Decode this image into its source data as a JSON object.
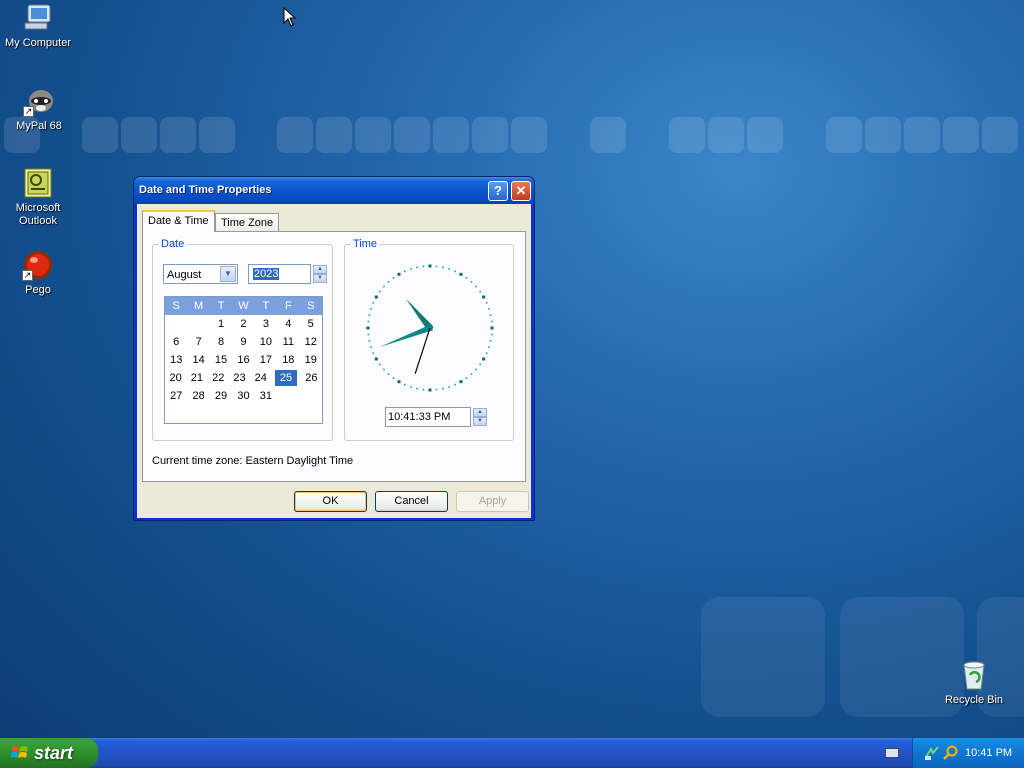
{
  "desktop": {
    "icons": [
      {
        "label": "My Computer"
      },
      {
        "label": "MyPal 68"
      },
      {
        "label": "Microsoft Outlook"
      },
      {
        "label": "Pego"
      },
      {
        "label": "Recycle Bin"
      }
    ]
  },
  "window": {
    "title": "Date and Time Properties",
    "help_glyph": "?",
    "close_glyph": "✕",
    "tabs": [
      {
        "label": "Date & Time",
        "active": true
      },
      {
        "label": "Time Zone",
        "active": false
      }
    ],
    "date_group": {
      "label": "Date",
      "month": "August",
      "year": "2023",
      "calendar": {
        "weekdays": [
          "S",
          "M",
          "T",
          "W",
          "T",
          "F",
          "S"
        ],
        "weeks": [
          [
            "",
            "",
            "1",
            "2",
            "3",
            "4",
            "5"
          ],
          [
            "6",
            "7",
            "8",
            "9",
            "10",
            "11",
            "12"
          ],
          [
            "13",
            "14",
            "15",
            "16",
            "17",
            "18",
            "19"
          ],
          [
            "20",
            "21",
            "22",
            "23",
            "24",
            "25",
            "26"
          ],
          [
            "27",
            "28",
            "29",
            "30",
            "31",
            "",
            ""
          ]
        ],
        "selected_day": "25"
      }
    },
    "time_group": {
      "label": "Time",
      "time_value": "10:41:33 PM",
      "clock": {
        "hours": 10,
        "minutes": 41,
        "seconds": 33
      }
    },
    "current_time_zone": "Current time zone:  Eastern Daylight Time",
    "buttons": {
      "ok": "OK",
      "cancel": "Cancel",
      "apply": "Apply"
    }
  },
  "taskbar": {
    "start_label": "start",
    "clock": "10:41 PM"
  }
}
